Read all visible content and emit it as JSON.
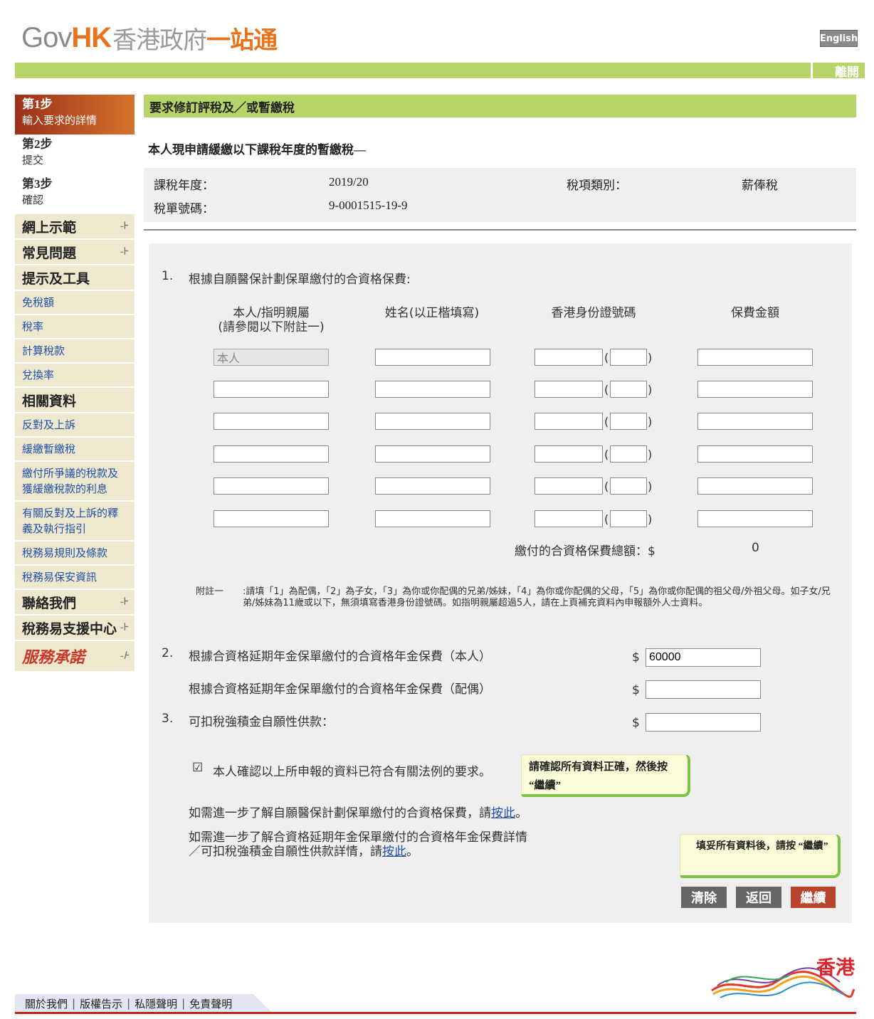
{
  "header": {
    "logo_gov": "Gov",
    "logo_hk": "HK",
    "logo_cn": "香港政府",
    "logo_cn2": "一站通",
    "lang_label": "English",
    "exit_label": "離開"
  },
  "sidebar": {
    "steps": [
      {
        "title": "第1步",
        "subtitle": "輸入要求的詳情",
        "active": true
      },
      {
        "title": "第2步",
        "subtitle": "提交",
        "active": false
      },
      {
        "title": "第3步",
        "subtitle": "確認",
        "active": false
      }
    ],
    "items": [
      {
        "label": "網上示範",
        "type": "big",
        "arrow": true
      },
      {
        "label": "常見問題",
        "type": "big",
        "arrow": true
      },
      {
        "label": "提示及工具",
        "type": "big",
        "arrow": false
      },
      {
        "label": "免稅額",
        "type": "small"
      },
      {
        "label": "稅率",
        "type": "small"
      },
      {
        "label": "計算稅款",
        "type": "small"
      },
      {
        "label": "兌換率",
        "type": "small"
      },
      {
        "label": "相關資料",
        "type": "big",
        "arrow": false
      },
      {
        "label": "反對及上訴",
        "type": "small"
      },
      {
        "label": "緩繳暫繳稅",
        "type": "small"
      },
      {
        "label": "繳付所爭議的稅款及獲緩繳稅款的利息",
        "type": "small"
      },
      {
        "label": "有關反對及上訴的釋義及執行指引",
        "type": "small"
      },
      {
        "label": "稅務易規則及條款",
        "type": "small"
      },
      {
        "label": "稅務易保安資訊",
        "type": "small"
      },
      {
        "label": "聯絡我們",
        "type": "big",
        "arrow": true
      },
      {
        "label": "稅務易支援中心",
        "type": "big",
        "arrow": true
      }
    ],
    "promise_label": "服務承諾",
    "arrow_glyph": "-⊦"
  },
  "main": {
    "title": "要求修訂評稅及／或暫繳稅",
    "intro": "本人現申請緩繳以下課稅年度的暫繳稅—",
    "info": {
      "year_label": "課稅年度：",
      "year_value": "2019/20",
      "tax_type_label": "稅項類別：",
      "tax_type_value": "薪俸稅",
      "file_no_label": "稅單號碼：",
      "file_no_value": "9-0001515-19-9"
    },
    "q1": {
      "num": "1.",
      "text": "根據自願醫保計劃保單繳付的合資格保費:",
      "col_relation": "本人/指明親屬",
      "col_relation_sub": "(請參閱以下附註一)",
      "col_name": "姓名(以正楷填寫)",
      "col_hkid": "香港身份證號碼",
      "col_premium": "保費金額",
      "first_row_relation": "本人",
      "paren_open": "(",
      "paren_close": ")",
      "total_label": "繳付的合資格保費總額：$",
      "total_value": "0",
      "note_label": "附註一",
      "note_text": ":請填「1」為配偶，「2」為子女，「3」為你或你配偶的兄弟/姊妹，「4」為你或你配偶的父母，「5」為你或你配偶的祖父母/外祖父母。如子女/兄弟/姊妹為11歲或以下，無須填寫香港身份證號碼。如指明親屬超過5人，請在上頁補充資料內申報額外人士資料。"
    },
    "q2": {
      "num": "2.",
      "text_self": "根據合資格延期年金保單繳付的合資格年金保費（本人）",
      "value_self": "60000",
      "text_spouse": "根據合資格延期年金保單繳付的合資格年金保費（配偶）",
      "value_spouse": ""
    },
    "q3": {
      "num": "3.",
      "text": "可扣稅強積金自願性供款：",
      "value": ""
    },
    "currency": "$",
    "confirm_text": "本人確認以上所申報的資料已符合有關法例的要求。",
    "tip_confirm": "請確認所有資料正確，然後按 “繼續”",
    "info1_prefix": "如需進一步了解自願醫保計劃保單繳付的合資格保費，請",
    "info1_link": "按此",
    "info1_suffix": "。",
    "info2_prefix_line1": "如需進一步了解合資格延期年金保單繳付的合資格年金保費詳情",
    "info2_prefix_line2": "／可扣稅強積金自願性供款詳情，請",
    "info2_link": "按此",
    "info2_suffix": "。",
    "tip_continue": "填妥所有資料後，請按 “繼續”",
    "buttons": {
      "clear": "清除",
      "back": "返回",
      "continue": "繼續"
    }
  },
  "footer": {
    "links": [
      "關於我們",
      "版權告示",
      "私隱聲明",
      "免責聲明"
    ],
    "separator": "|",
    "brand_text": "香港"
  }
}
